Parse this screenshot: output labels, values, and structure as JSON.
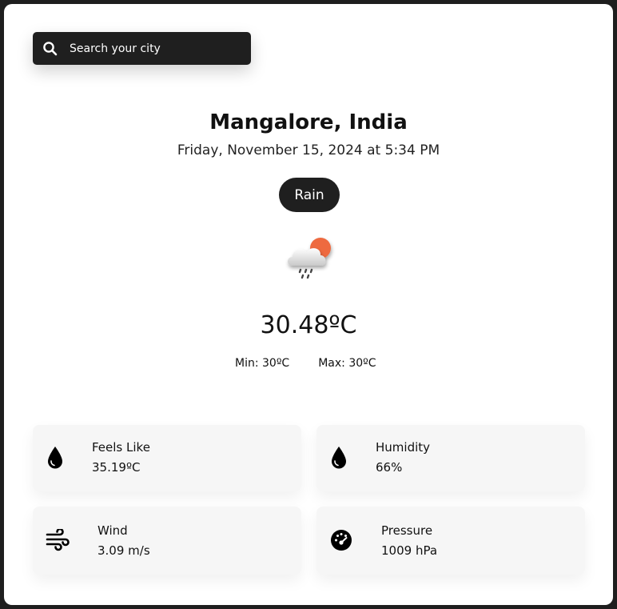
{
  "search": {
    "placeholder": "Search your city",
    "icon": "search-icon"
  },
  "location": {
    "city": "Mangalore, India",
    "datetime": "Friday, November 15, 2024 at 5:34 PM"
  },
  "weather": {
    "condition": "Rain",
    "icon": "rain-cloud-sun-icon",
    "temperature": "30.48ºC",
    "min": "Min: 30ºC",
    "max": "Max: 30ºC"
  },
  "stats": {
    "feels_like": {
      "label": "Feels Like",
      "value": "35.19ºC",
      "icon": "droplet-icon"
    },
    "humidity": {
      "label": "Humidity",
      "value": "66%",
      "icon": "droplet-icon"
    },
    "wind": {
      "label": "Wind",
      "value": "3.09 m/s",
      "icon": "wind-icon"
    },
    "pressure": {
      "label": "Pressure",
      "value": "1009 hPa",
      "icon": "gauge-icon"
    }
  },
  "colors": {
    "dark": "#1f1f1f",
    "card_bg": "#ffffff",
    "stat_bg": "#f6f6f6",
    "sun": "#ee6a3f"
  }
}
